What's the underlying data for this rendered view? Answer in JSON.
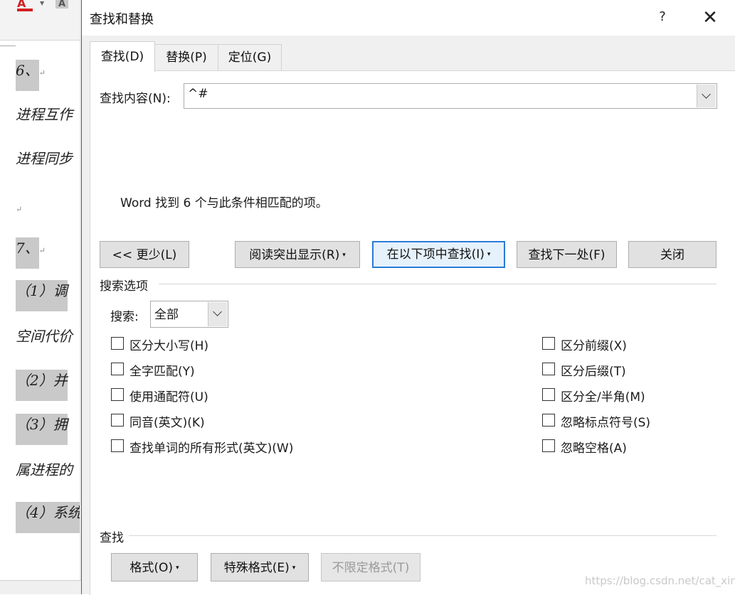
{
  "document": {
    "lines": [
      {
        "text": "6、",
        "shaded": true
      },
      {
        "text": "进程互作",
        "shaded": false
      },
      {
        "text": "进程同步",
        "shaded": false
      },
      {
        "text": "",
        "shaded": false
      },
      {
        "text": "7、",
        "shaded": true
      },
      {
        "text": "（1）调",
        "shaded": true
      },
      {
        "text": "空间代价",
        "shaded": false
      },
      {
        "text": "（2）并",
        "shaded": true
      },
      {
        "text": "（3）拥",
        "shaded": true
      },
      {
        "text": "属进程的",
        "shaded": false
      },
      {
        "text": "（4）系统",
        "shaded": true
      }
    ],
    "paragraph_mark": "↵",
    "ribbon_font_color_glyph": "A",
    "ribbon_shade_glyph": "A"
  },
  "dialog": {
    "title": "查找和替换",
    "help_glyph": "?",
    "close_glyph": "✕",
    "tabs": [
      {
        "label": "查找(D)",
        "active": true
      },
      {
        "label": "替换(P)",
        "active": false
      },
      {
        "label": "定位(G)",
        "active": false
      }
    ],
    "find": {
      "label": "查找内容(N):",
      "value": "^#"
    },
    "result_message": "Word 找到 6 个与此条件相匹配的项。",
    "buttons": {
      "less": "<< 更少(L)",
      "reading_highlight": "阅读突出显示(R)",
      "find_in": "在以下项中查找(I)",
      "find_next": "查找下一处(F)",
      "close": "关闭"
    },
    "search_options": {
      "heading": "搜索选项",
      "search_label": "搜索:",
      "search_value": "全部",
      "left_checkboxes": [
        {
          "label": "区分大小写(H)",
          "checked": false
        },
        {
          "label": "全字匹配(Y)",
          "checked": false
        },
        {
          "label": "使用通配符(U)",
          "checked": false
        },
        {
          "label": "同音(英文)(K)",
          "checked": false
        },
        {
          "label": "查找单词的所有形式(英文)(W)",
          "checked": false
        }
      ],
      "right_checkboxes": [
        {
          "label": "区分前缀(X)",
          "checked": false
        },
        {
          "label": "区分后缀(T)",
          "checked": false
        },
        {
          "label": "区分全/半角(M)",
          "checked": false
        },
        {
          "label": "忽略标点符号(S)",
          "checked": false
        },
        {
          "label": "忽略空格(A)",
          "checked": false
        }
      ]
    },
    "find_section": {
      "heading": "查找",
      "format_button": "格式(O)",
      "special_button": "特殊格式(E)",
      "no_format_button": "不限定格式(T)"
    },
    "caret_glyph": "▾"
  },
  "watermark": "https://blog.csdn.net/cat_xing"
}
